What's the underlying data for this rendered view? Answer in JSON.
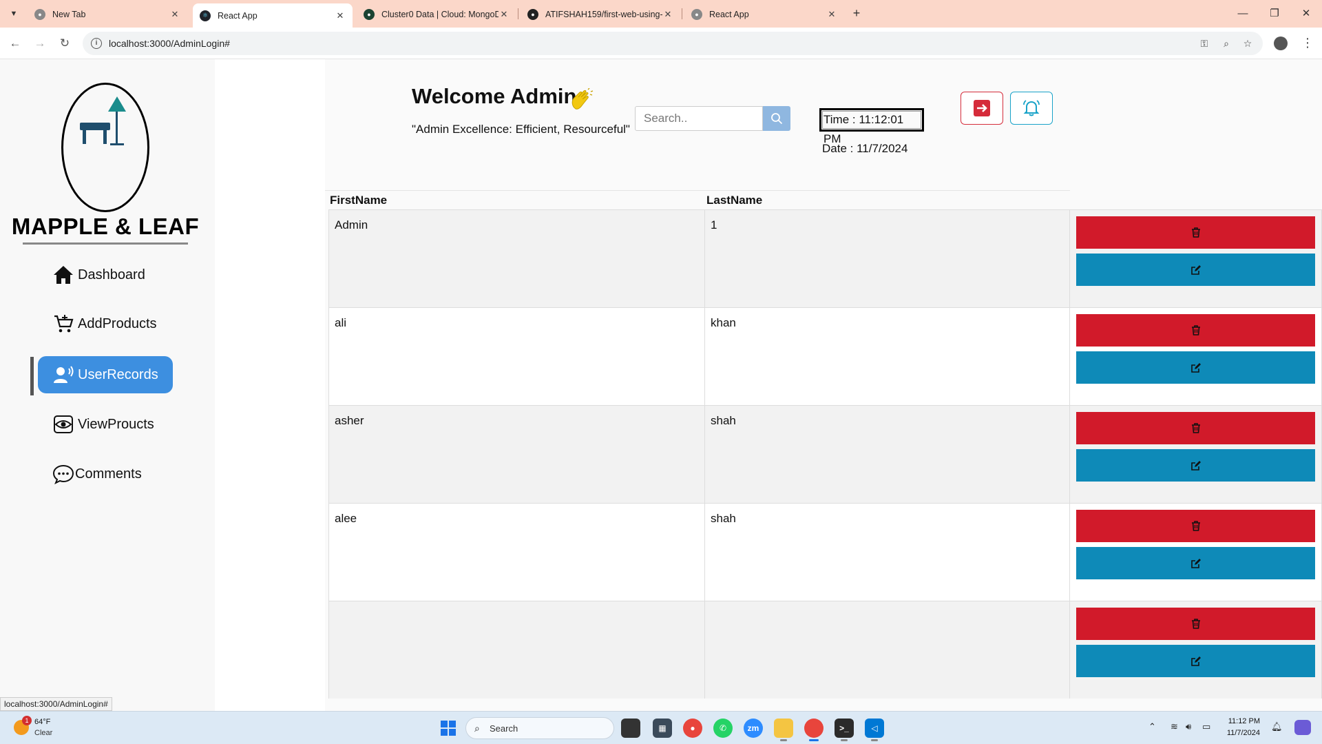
{
  "browser": {
    "tabs": [
      {
        "title": "New Tab",
        "active": false
      },
      {
        "title": "React App",
        "active": true
      },
      {
        "title": "Cluster0 Data | Cloud: MongoD",
        "active": false
      },
      {
        "title": "ATIFSHAH159/first-web-using-",
        "active": false
      },
      {
        "title": "React App",
        "active": false
      }
    ],
    "url": "localhost:3000/AdminLogin#"
  },
  "sidebar": {
    "brand": "MAPPLE & LEAF",
    "items": [
      {
        "label": "Dashboard",
        "icon": "home-icon",
        "active": false
      },
      {
        "label": "AddProducts",
        "icon": "cart-icon",
        "active": false
      },
      {
        "label": "UserRecords",
        "icon": "user-voice-icon",
        "active": true
      },
      {
        "label": "ViewProucts",
        "icon": "eye-icon",
        "active": false
      },
      {
        "label": "Comments",
        "icon": "chat-icon",
        "active": false
      }
    ]
  },
  "header": {
    "greeting": "Welcome Admin",
    "quote": "\"Admin Excellence: Efficient, Resourceful\"",
    "search_placeholder": "Search..",
    "time": "Time : 11:12:01 PM",
    "date": "Date : 11/7/2024"
  },
  "table": {
    "columns": [
      "FirstName",
      "LastName"
    ],
    "rows": [
      {
        "first": "Admin",
        "last": "1"
      },
      {
        "first": "ali",
        "last": "khan"
      },
      {
        "first": "asher",
        "last": "shah"
      },
      {
        "first": "alee",
        "last": "shah"
      },
      {
        "first": "",
        "last": ""
      }
    ]
  },
  "status_url": "localhost:3000/AdminLogin#",
  "taskbar": {
    "weather_temp": "64°F",
    "weather_cond": "Clear",
    "weather_badge": "1",
    "search_label": "Search",
    "time": "11:12 PM",
    "date": "11/7/2024"
  },
  "colors": {
    "accent": "#3d8fe0",
    "delete": "#d11a2a",
    "edit": "#0e8ab8",
    "tabbar": "#fbd7c9"
  }
}
